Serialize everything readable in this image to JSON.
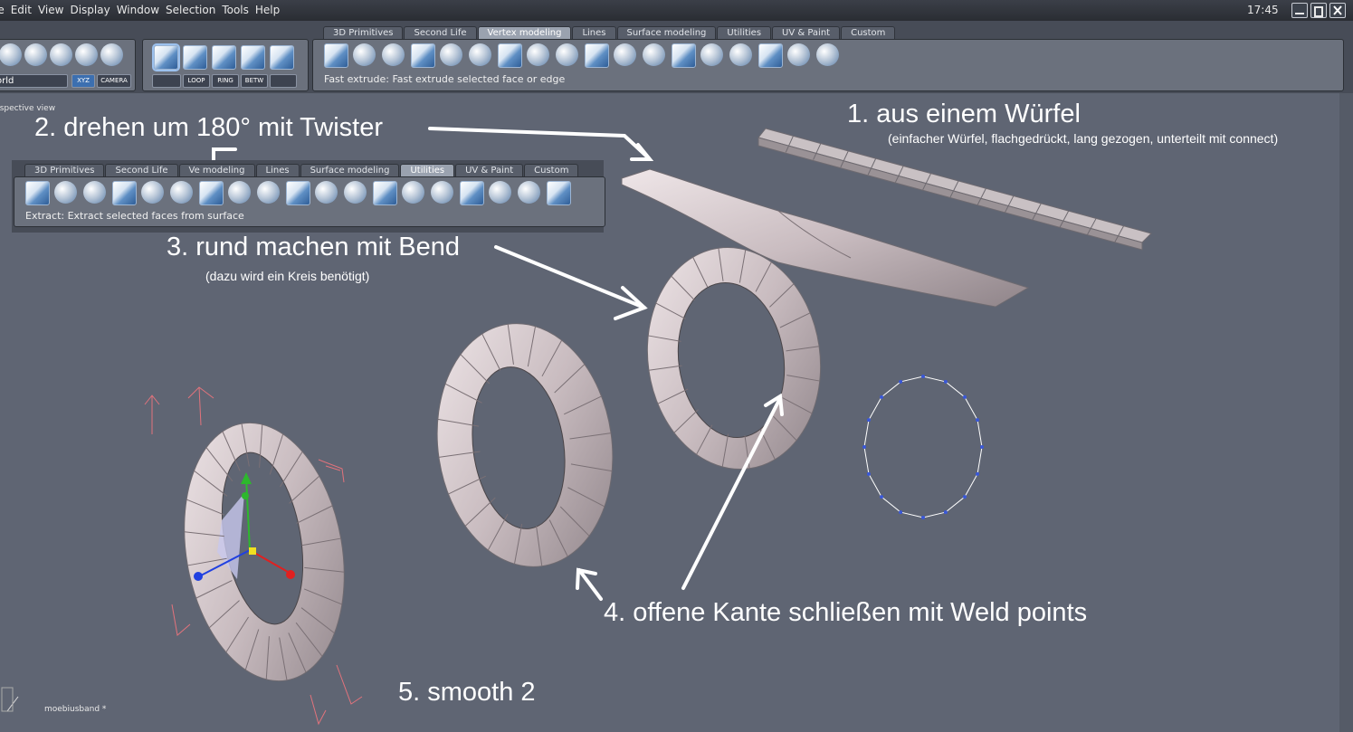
{
  "menubar": {
    "items": [
      "le",
      "Edit",
      "View",
      "Display",
      "Window",
      "Selection",
      "Tools",
      "Help"
    ],
    "clock": "17:45"
  },
  "toolbar_left": {
    "world_select": "orld",
    "xyz": "XYZ",
    "camera": "CAMERA",
    "loop": "LOOP",
    "ring": "RING",
    "betw": "BETW"
  },
  "main_tabs": [
    "3D Primitives",
    "Second Life",
    "Vertex modeling",
    "Lines",
    "Surface modeling",
    "Utilities",
    "UV & Paint",
    "Custom"
  ],
  "main_active_tab": "Vertex modeling",
  "main_status": "Fast extrude: Fast extrude selected face or edge",
  "viewport_label": "rspective view",
  "inset": {
    "tabs": [
      "3D Primitives",
      "Second Life",
      "Vertex modeling",
      "Lines",
      "Surface modeling",
      "Utilities",
      "UV & Paint",
      "Custom"
    ],
    "tab3_visible": "Ve   modeling",
    "active_tab": "Utilities",
    "status": "Extract: Extract selected faces from surface"
  },
  "annotations": {
    "a1": "1. aus einem Würfel",
    "a1_sub": "(einfacher Würfel, flachgedrückt, lang gezogen, unterteilt mit connect)",
    "a2": "2. drehen um 180° mit Twister",
    "a3": "3. rund machen mit Bend",
    "a3_sub": "(dazu wird ein Kreis benötigt)",
    "a4": "4. offene Kante schließen mit Weld points",
    "a5": "5. smooth 2"
  },
  "file_label": "moebiusband *",
  "icons": {
    "minimize": "minimize-icon",
    "maximize": "maximize-icon",
    "close": "close-icon"
  },
  "colors": {
    "viewport": "#5f6573",
    "mesh": "#d9ccd0",
    "text": "#ffffff"
  }
}
